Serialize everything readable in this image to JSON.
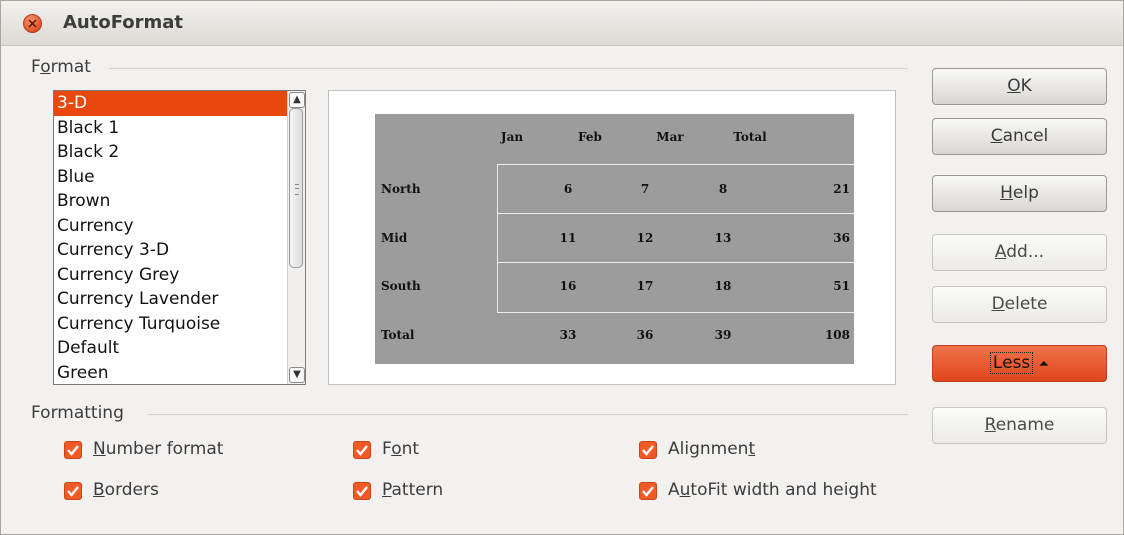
{
  "window": {
    "title": "AutoFormat",
    "accent": "#e8470e"
  },
  "format": {
    "section_label_pre": "F",
    "section_label_key": "o",
    "section_label_post": "rmat",
    "items": [
      "3-D",
      "Black 1",
      "Black 2",
      "Blue",
      "Brown",
      "Currency",
      "Currency 3-D",
      "Currency Grey",
      "Currency Lavender",
      "Currency Turquoise",
      "Default",
      "Green"
    ],
    "selected": "3-D"
  },
  "preview": {
    "columns": [
      "Jan",
      "Feb",
      "Mar",
      "Total"
    ],
    "rows": [
      {
        "label": "North",
        "values": [
          "6",
          "7",
          "8",
          "21"
        ]
      },
      {
        "label": "Mid",
        "values": [
          "11",
          "12",
          "13",
          "36"
        ]
      },
      {
        "label": "South",
        "values": [
          "16",
          "17",
          "18",
          "51"
        ]
      },
      {
        "label": "Total",
        "values": [
          "33",
          "36",
          "39",
          "108"
        ]
      }
    ]
  },
  "formatting": {
    "section_label": "Formatting",
    "options": {
      "number_format": {
        "key": "N",
        "rest": "umber format",
        "checked": true
      },
      "borders": {
        "key": "B",
        "rest": "orders",
        "checked": true
      },
      "font": {
        "pre": "F",
        "key": "o",
        "rest": "nt",
        "checked": true
      },
      "pattern": {
        "key": "P",
        "rest": "attern",
        "checked": true
      },
      "alignment": {
        "pre": "Alignmen",
        "key": "t",
        "rest": "",
        "checked": true
      },
      "autofit": {
        "pre": "A",
        "key": "u",
        "rest": "toFit width and height",
        "checked": true
      }
    }
  },
  "buttons": {
    "ok": {
      "key": "O",
      "rest": "K"
    },
    "cancel": {
      "key": "C",
      "rest": "ancel"
    },
    "help": {
      "key": "H",
      "rest": "elp"
    },
    "add": {
      "key": "A",
      "rest": "dd..."
    },
    "delete": {
      "key": "D",
      "rest": "elete"
    },
    "less": {
      "label": "Less",
      "icon": "double-chevron-up-icon"
    },
    "rename": {
      "key": "R",
      "rest": "ename"
    }
  }
}
